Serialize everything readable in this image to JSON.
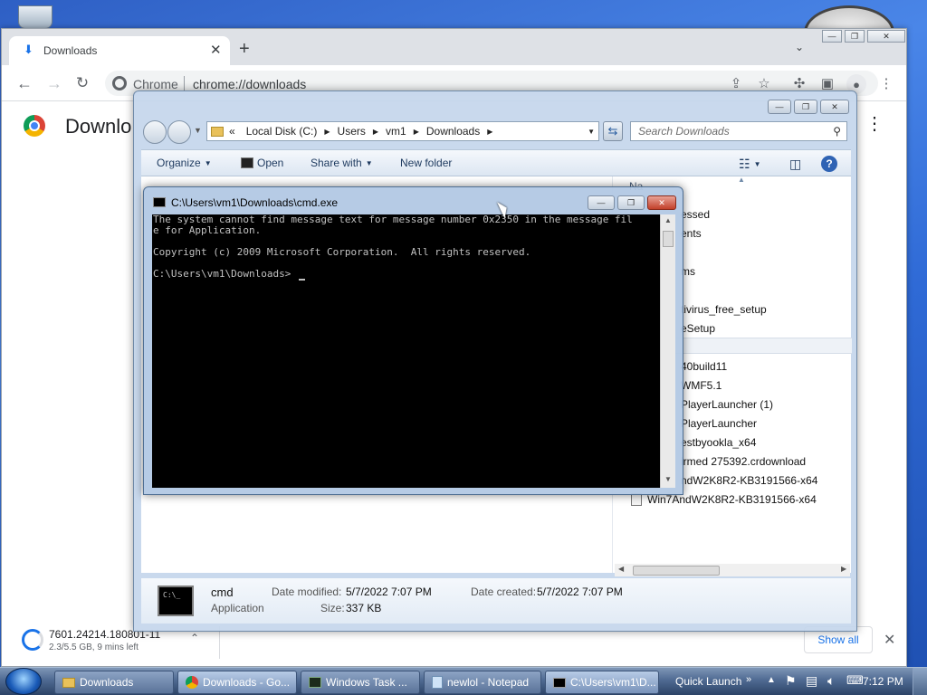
{
  "chrome": {
    "tab_title": "Downloads",
    "omnibox_site": "Chrome",
    "omnibox_url": "chrome://downloads",
    "page_heading": "Downlo",
    "download_item": {
      "name": "7601.24214.180801-11",
      "status": "2.3/5.5 GB, 9 mins left"
    },
    "show_all": "Show all",
    "icons": [
      "back-arrow",
      "forward-arrow",
      "reload",
      "share",
      "star",
      "extensions",
      "side-panel",
      "profile",
      "kebab-menu",
      "new-tab-plus",
      "close-x",
      "tab-search-chevron"
    ]
  },
  "explorer": {
    "breadcrumb": [
      "«",
      "Local Disk (C:)",
      "Users",
      "vm1",
      "Downloads"
    ],
    "search_placeholder": "Search Downloads",
    "commands": {
      "organize": "Organize",
      "open": "Open",
      "share_with": "Share with",
      "new_folder": "New folder"
    },
    "column_header_fragment": "Na",
    "files": [
      "essed",
      "ents",
      "ms",
      "tivirus_free_setup",
      "eSetup",
      "40build11",
      "WMF5.1",
      "PlayerLauncher (1)",
      "PlayerLauncher",
      "estbyookla_x64",
      "irmed 275392.crdownload",
      "ndW2K8R2-KB3191566-x64",
      "Win7AndW2K8R2-KB3191566-x64"
    ],
    "details": {
      "name": "cmd",
      "type": "Application",
      "date_modified_label": "Date modified:",
      "date_modified": "5/7/2022 7:07 PM",
      "date_created_label": "Date created:",
      "date_created": "5/7/2022 7:07 PM",
      "size_label": "Size:",
      "size": "337 KB"
    }
  },
  "cmd": {
    "title": "C:\\Users\\vm1\\Downloads\\cmd.exe",
    "lines": [
      "The system cannot find message text for message number 0x2350 in the message fil",
      "e for Application.",
      "",
      "Copyright (c) 2009 Microsoft Corporation.  All rights reserved.",
      "",
      "C:\\Users\\vm1\\Downloads>"
    ]
  },
  "taskbar": {
    "buttons": [
      "Downloads",
      "Downloads - Go...",
      "Windows Task ...",
      "newlol - Notepad",
      "C:\\Users\\vm1\\D..."
    ],
    "quick_launch": "Quick Launch",
    "time": "7:12 PM"
  },
  "colors": {
    "desktop": "#2f6ad6",
    "chrome_tabstrip": "#dee1e6",
    "cmd_bg": "#000000",
    "cmd_text": "#c0c0c0",
    "chrome_link": "#1a73e8"
  }
}
